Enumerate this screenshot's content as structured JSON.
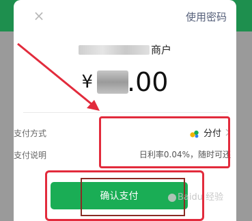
{
  "dialog": {
    "close_icon": "×",
    "use_password_label": "使用密码",
    "merchant_suffix": "商户",
    "currency_symbol": "¥",
    "amount_tail": ".00"
  },
  "details": {
    "pay_method_label": "支付方式",
    "pay_method_value": "分付",
    "pay_note_label": "支付说明",
    "pay_note_value": "日利率0.04%，随时可还"
  },
  "actions": {
    "confirm_label": "确认支付"
  },
  "watermark": {
    "text": "Baidu 经验"
  },
  "colors": {
    "primary_green": "#1aad55",
    "top_bar_green": "#1e8f4e",
    "annotation_red": "#e22b3c",
    "link_blue_gray": "#56607a"
  },
  "icons": {
    "close": "close-icon",
    "chevron": "chevron-right-icon",
    "fenfu": "fenfu-icon"
  }
}
